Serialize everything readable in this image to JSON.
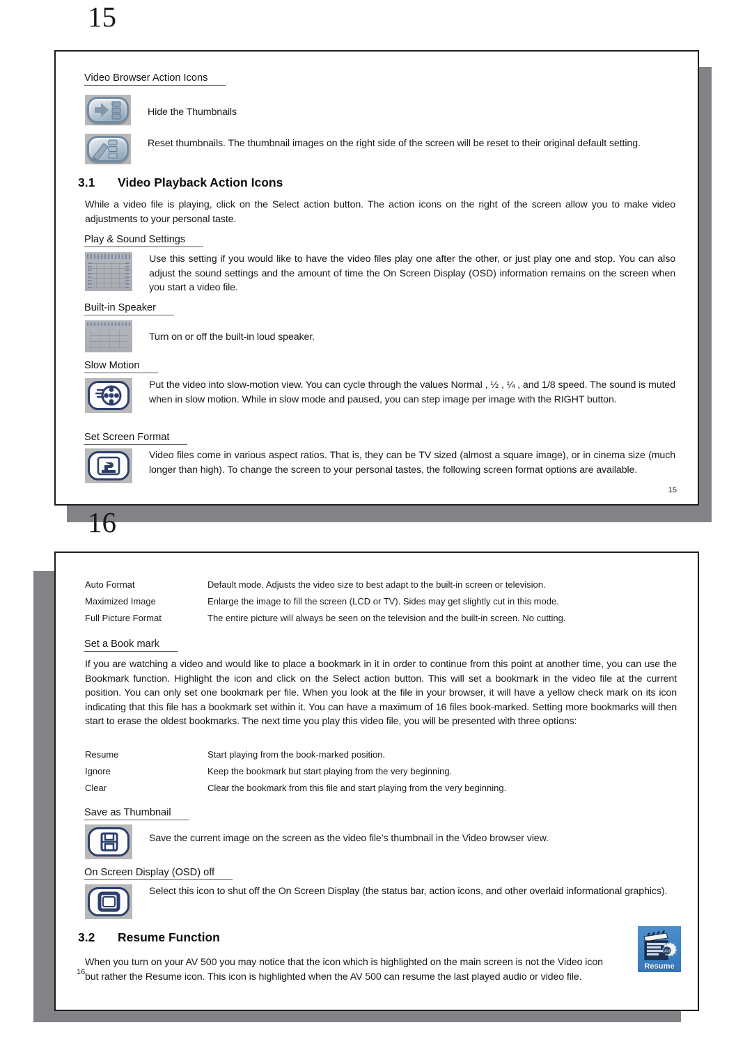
{
  "document": {
    "page_numbers": {
      "first": "15",
      "second": "16"
    },
    "footers": {
      "first": "15",
      "second": "16"
    }
  },
  "page1": {
    "browser_icons_heading": "Video Browser Action Icons",
    "items": [
      {
        "icon": "hide-thumbnails-icon",
        "text": "Hide the Thumbnails"
      },
      {
        "icon": "reset-thumbnails-icon",
        "text": "Reset thumbnails. The thumbnail images on the right side of the screen will be reset to their original default setting."
      }
    ],
    "section": {
      "number": "3.1",
      "title": "Video Playback Action Icons",
      "intro": "While a video file is playing, click on the Select  action button. The action icons on the right of the screen allow you to make video adjustments to your personal taste."
    },
    "play_sound": {
      "heading": "Play & Sound Settings",
      "icon": "play-sound-settings-screenshot",
      "text": "Use this setting if you would like to have the video files play one after the other, or just play one and stop. You can also adjust the sound settings and the amount of time the On Screen Display (OSD) information remains on the screen when you start a video file."
    },
    "speaker": {
      "heading": "Built-in Speaker",
      "icon": "built-in-speaker-screenshot",
      "text": "Turn on or off the built-in loud speaker."
    },
    "slow_motion": {
      "heading": "Slow Motion",
      "icon": "slow-motion-icon",
      "text": "Put the video into slow-motion view. You can cycle through the values Normal , ½ , ¼ , and 1/8 speed. The sound is muted when in slow motion. While in slow mode and paused, you can step image per image with the RIGHT button."
    },
    "screen_format": {
      "heading": "Set Screen Format",
      "icon": "set-screen-format-icon",
      "text": "Video files come in various aspect ratios. That is, they can be TV sized (almost a square image), or in cinema size (much longer than high). To change the screen to your personal tastes, the following screen format options are available."
    }
  },
  "page2": {
    "format_options": [
      {
        "term": "Auto Format",
        "desc": "Default mode. Adjusts the video size to best adapt to the built-in screen or television."
      },
      {
        "term": "Maximized Image",
        "desc": "Enlarge the image to fill the screen (LCD or TV). Sides may get slightly cut in this mode."
      },
      {
        "term": "Full Picture Format",
        "desc": "The entire picture will always be seen on the television and the built-in screen. No cutting."
      }
    ],
    "bookmark": {
      "heading": "Set a Book mark",
      "text": "If you are watching a video and would like to place a bookmark in it in order to continue from this point at another time, you can use the Bookmark function. Highlight the icon and click on the Select  action button. This will set a bookmark in the video file at the current position. You can only set one bookmark per file. When you look at the file in your browser, it will have a yellow check mark on its icon indicating that this file has a bookmark set within it. You can have a maximum of 16 files book-marked. Setting more bookmarks will then start to erase the oldest bookmarks. The next time you play this video file, you will be presented with three options:"
    },
    "bookmark_options": [
      {
        "term": "Resume",
        "desc": "Start playing from the book-marked position."
      },
      {
        "term": "Ignore",
        "desc": "Keep the bookmark but start playing from the very beginning."
      },
      {
        "term": "Clear",
        "desc": "Clear the bookmark from this file and start playing from the very beginning."
      }
    ],
    "save_thumbnail": {
      "heading": "Save as Thumbnail",
      "icon": "save-thumbnail-icon",
      "text": "Save the current image on the screen as the video file’s thumbnail in the Video browser view."
    },
    "osd_off": {
      "heading": "On Screen Display (OSD) off",
      "icon": "osd-off-icon",
      "text": "Select this icon to shut off the On Screen Display (the status bar, action icons, and other overlaid informational graphics)."
    },
    "section": {
      "number": "3.2",
      "title": "Resume Function",
      "text": "When you turn on your AV 500 you may notice that the icon which is highlighted on the main screen is not the Video  icon but rather the Resume  icon. This icon is highlighted when the AV 500 can resume the last played audio or video file."
    },
    "resume_tile": {
      "label": "Resume",
      "icon": "resume-clapperboard-gear-icon",
      "color": "#3d81c4"
    }
  }
}
